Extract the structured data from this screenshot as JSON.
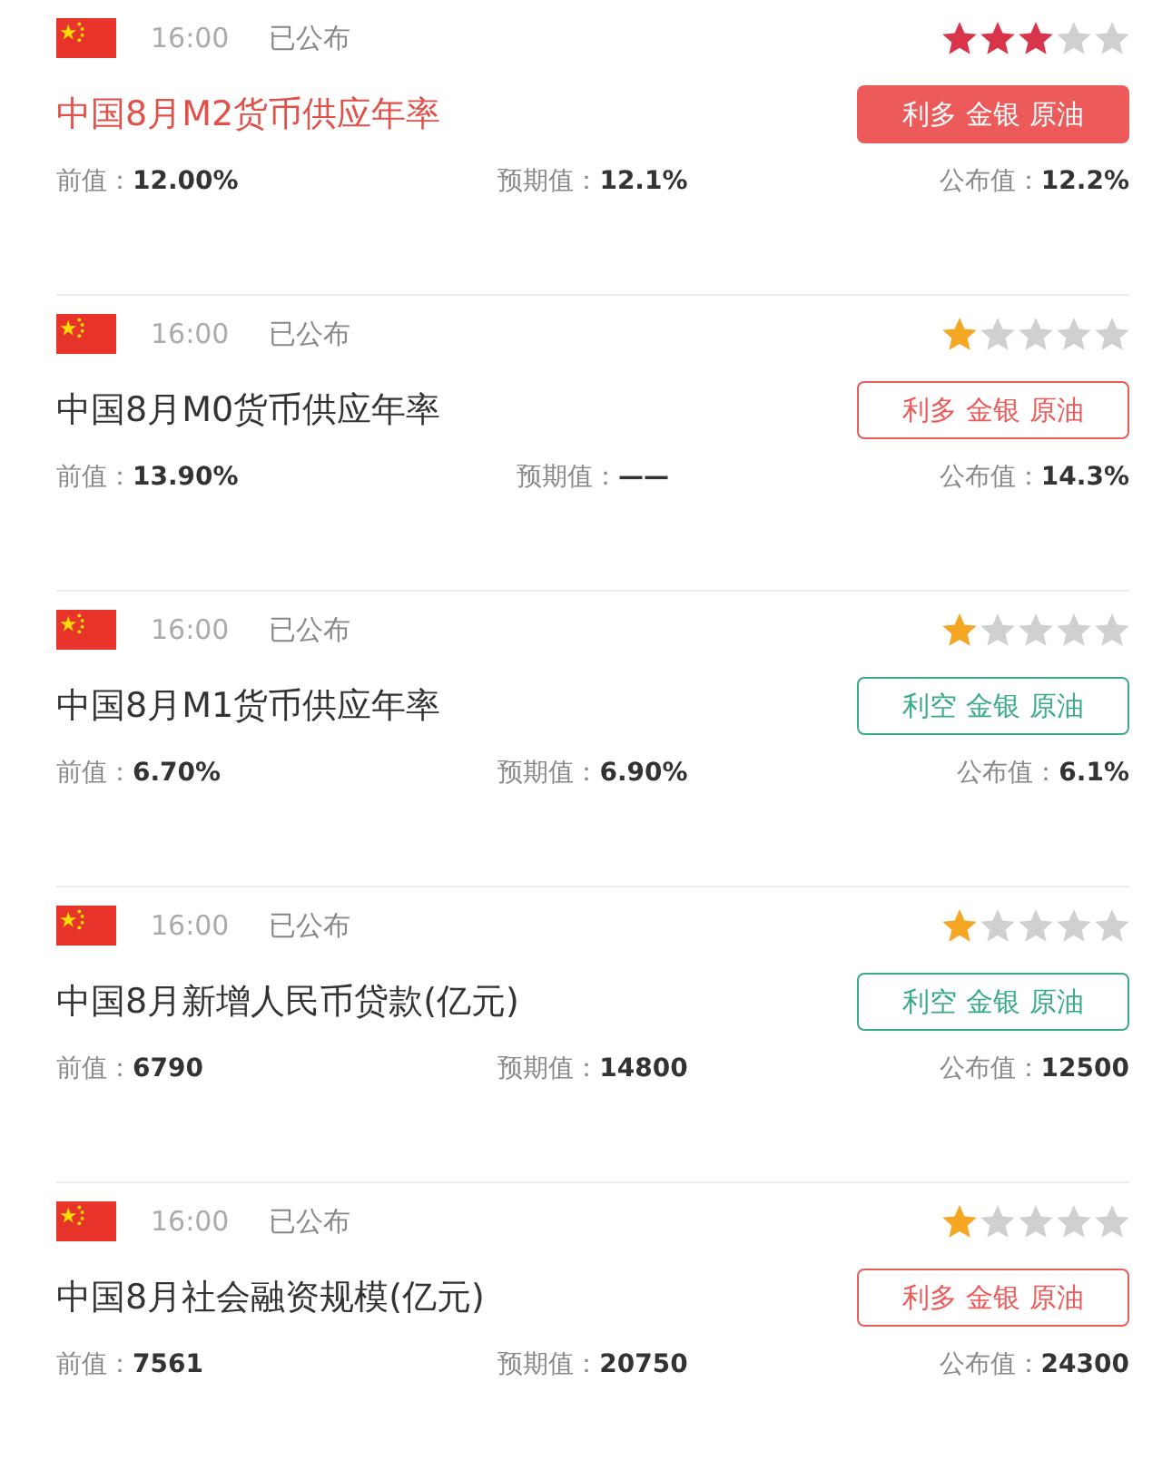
{
  "events": [
    {
      "time": "16:00",
      "status": "已公布",
      "stars": 3,
      "highlighted": true,
      "title": "中国8月M2货币供应年率",
      "tag": {
        "text": "利多 金银 原油",
        "kind": "bullish"
      },
      "values": [
        {
          "label": "前值：",
          "value": "12.00%"
        },
        {
          "label": "预期值：",
          "value": "12.1%"
        },
        {
          "label": "公布值：",
          "value": "12.2%"
        }
      ]
    },
    {
      "time": "16:00",
      "status": "已公布",
      "stars": 1,
      "highlighted": false,
      "title": "中国8月M0货币供应年率",
      "tag": {
        "text": "利多 金银 原油",
        "kind": "bullish"
      },
      "values": [
        {
          "label": "前值：",
          "value": "13.90%"
        },
        {
          "label": "预期值：",
          "value": "——"
        },
        {
          "label": "公布值：",
          "value": "14.3%"
        }
      ]
    },
    {
      "time": "16:00",
      "status": "已公布",
      "stars": 1,
      "highlighted": false,
      "title": "中国8月M1货币供应年率",
      "tag": {
        "text": "利空 金银 原油",
        "kind": "bearish"
      },
      "values": [
        {
          "label": "前值：",
          "value": "6.70%"
        },
        {
          "label": "预期值：",
          "value": "6.90%"
        },
        {
          "label": "公布值：",
          "value": "6.1%"
        }
      ]
    },
    {
      "time": "16:00",
      "status": "已公布",
      "stars": 1,
      "highlighted": false,
      "title": "中国8月新增人民币贷款(亿元)",
      "tag": {
        "text": "利空 金银 原油",
        "kind": "bearish"
      },
      "values": [
        {
          "label": "前值：",
          "value": "6790"
        },
        {
          "label": "预期值：",
          "value": "14800"
        },
        {
          "label": "公布值：",
          "value": "12500"
        }
      ]
    },
    {
      "time": "16:00",
      "status": "已公布",
      "stars": 1,
      "highlighted": false,
      "title": "中国8月社会融资规模(亿元)",
      "tag": {
        "text": "利多 金银 原油",
        "kind": "bullish"
      },
      "values": [
        {
          "label": "前值：",
          "value": "7561"
        },
        {
          "label": "预期值：",
          "value": "20750"
        },
        {
          "label": "公布值：",
          "value": "24300"
        }
      ]
    }
  ]
}
